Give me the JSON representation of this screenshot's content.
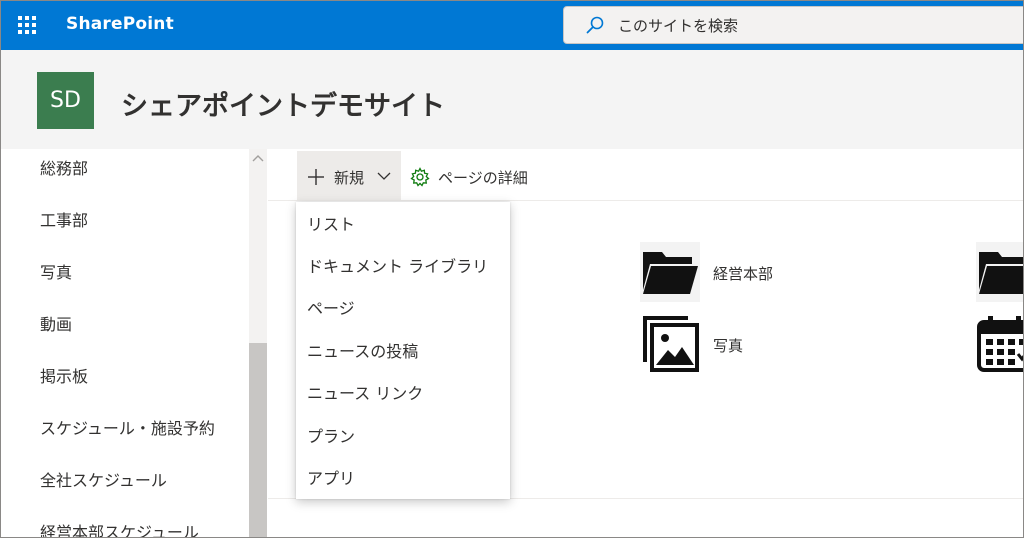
{
  "suite_bar": {
    "app_name": "SharePoint",
    "search_placeholder": "このサイトを検索",
    "accent_color": "#0078d4"
  },
  "site": {
    "logo_initials": "SD",
    "logo_color": "#3b7d4f",
    "title": "シェアポイントデモサイト"
  },
  "left_nav": {
    "items": [
      {
        "label": "総務部"
      },
      {
        "label": "工事部"
      },
      {
        "label": "写真"
      },
      {
        "label": "動画"
      },
      {
        "label": "掲示板"
      },
      {
        "label": "スケジュール・施設予約"
      },
      {
        "label": "全社スケジュール"
      },
      {
        "label": "経営本部スケジュール"
      }
    ]
  },
  "command_bar": {
    "new_label": "新規",
    "new_icon": "plus-icon",
    "page_details_label": "ページの詳細",
    "page_details_icon": "gear-icon"
  },
  "new_menu": {
    "items": [
      {
        "label": "リスト"
      },
      {
        "label": "ドキュメント ライブラリ"
      },
      {
        "label": "ページ"
      },
      {
        "label": "ニュースの投稿"
      },
      {
        "label": "ニュース リンク"
      },
      {
        "label": "プラン"
      },
      {
        "label": "アプリ"
      }
    ]
  },
  "quick_links": [
    {
      "label": "経営本部",
      "icon": "folder-open-icon"
    },
    {
      "label": "写真",
      "icon": "image-gallery-icon"
    },
    {
      "label": "",
      "icon": "folder-open-icon"
    },
    {
      "label": "",
      "icon": "calendar-icon"
    }
  ]
}
